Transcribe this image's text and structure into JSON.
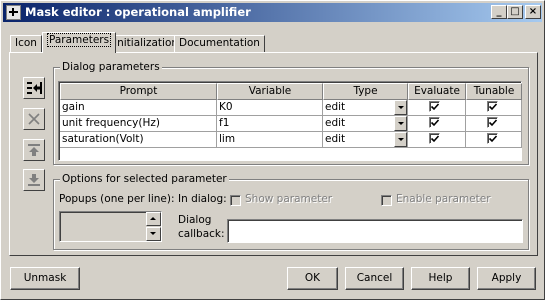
{
  "window": {
    "title": "Mask editor : operational amplifier",
    "controls": {
      "minimize": "_",
      "maximize": "□",
      "close": "×"
    }
  },
  "tabs": [
    {
      "label": "Icon",
      "active": false
    },
    {
      "label": "Parameters",
      "active": true
    },
    {
      "label": "Initialization",
      "active": false
    },
    {
      "label": "Documentation",
      "active": false
    }
  ],
  "side_toolbar": {
    "add_icon": "insert-parameter-icon",
    "delete_icon": "delete-parameter-icon",
    "move_up_icon": "move-up-icon",
    "move_down_icon": "move-down-icon"
  },
  "dialog_parameters": {
    "legend": "Dialog parameters",
    "columns": [
      "Prompt",
      "Variable",
      "Type",
      "Evaluate",
      "Tunable"
    ],
    "rows": [
      {
        "prompt": "gain",
        "variable": "K0",
        "type": "edit",
        "evaluate": true,
        "tunable": true
      },
      {
        "prompt": "unit frequency(Hz)",
        "variable": "f1",
        "type": "edit",
        "evaluate": true,
        "tunable": true
      },
      {
        "prompt": "saturation(Volt)",
        "variable": "lim",
        "type": "edit",
        "evaluate": true,
        "tunable": true
      }
    ]
  },
  "options": {
    "legend": "Options for selected parameter",
    "popups_label": "Popups (one per line):",
    "in_dialog_label": "In dialog:",
    "show_parameter_label": "Show parameter",
    "enable_parameter_label": "Enable parameter",
    "dialog_label": "Dialog",
    "callback_label": "callback:",
    "callback_value": ""
  },
  "buttons": {
    "unmask": "Unmask",
    "ok": "OK",
    "cancel": "Cancel",
    "help": "Help",
    "apply": "Apply"
  }
}
